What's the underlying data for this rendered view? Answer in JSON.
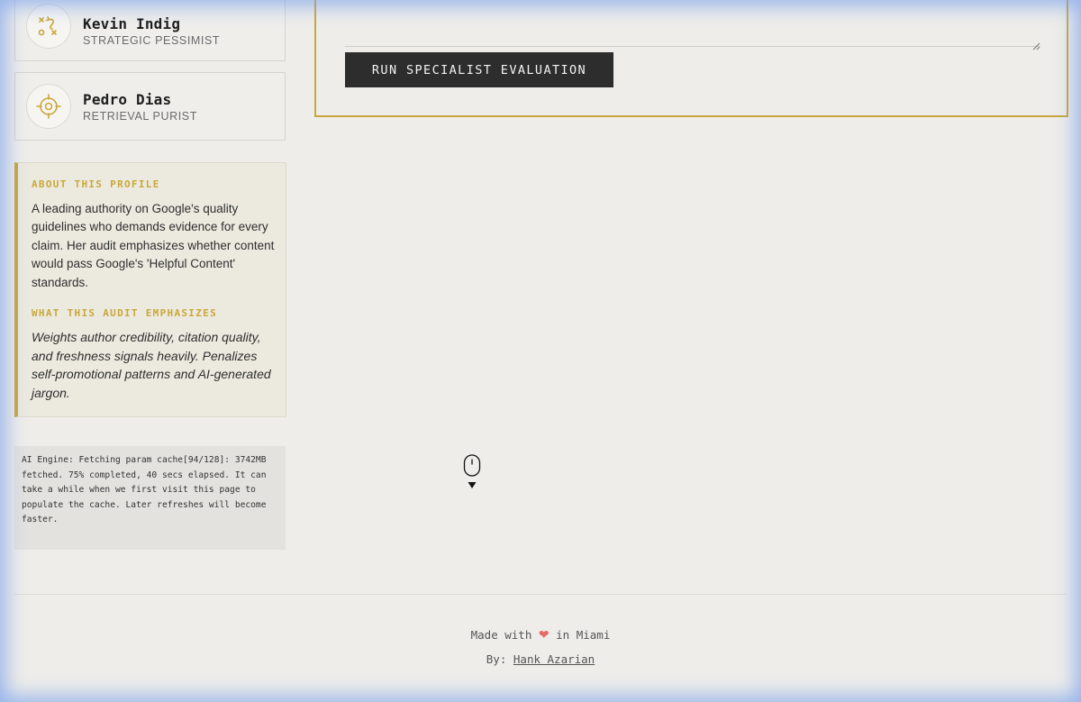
{
  "personas": [
    {
      "name": "Kevin Indig",
      "role": "STRATEGIC PESSIMIST",
      "icon": "strategy-play-icon"
    },
    {
      "name": "Pedro Dias",
      "role": "RETRIEVAL PURIST",
      "icon": "crosshair-target-icon"
    }
  ],
  "about": {
    "heading": "ABOUT THIS PROFILE",
    "body": "A leading authority on Google's quality guidelines who demands evidence for every claim. Her audit emphasizes whether content would pass Google's 'Helpful Content' standards.",
    "emphasis_heading": "WHAT THIS AUDIT EMPHASIZES",
    "emphasis_body": "Weights author credibility, citation quality, and freshness signals heavily. Penalizes self-promotional patterns and AI-generated jargon."
  },
  "engine_status": "AI Engine: Fetching param cache[94/128]: 3742MB fetched. 75% completed, 40 secs elapsed. It can take a while when we first visit this page to populate the cache. Later refreshes will become faster.",
  "evaluation": {
    "run_button_label": "RUN SPECIALIST EVALUATION"
  },
  "footer": {
    "made_prefix": "Made with",
    "heart": "❤",
    "made_suffix": "in Miami",
    "by_prefix": "By:",
    "author": "Hank Azarian"
  },
  "colors": {
    "accent": "#c9a83b",
    "background": "#eeedea",
    "button": "#2d2d2d",
    "heart": "#e46a6a"
  }
}
